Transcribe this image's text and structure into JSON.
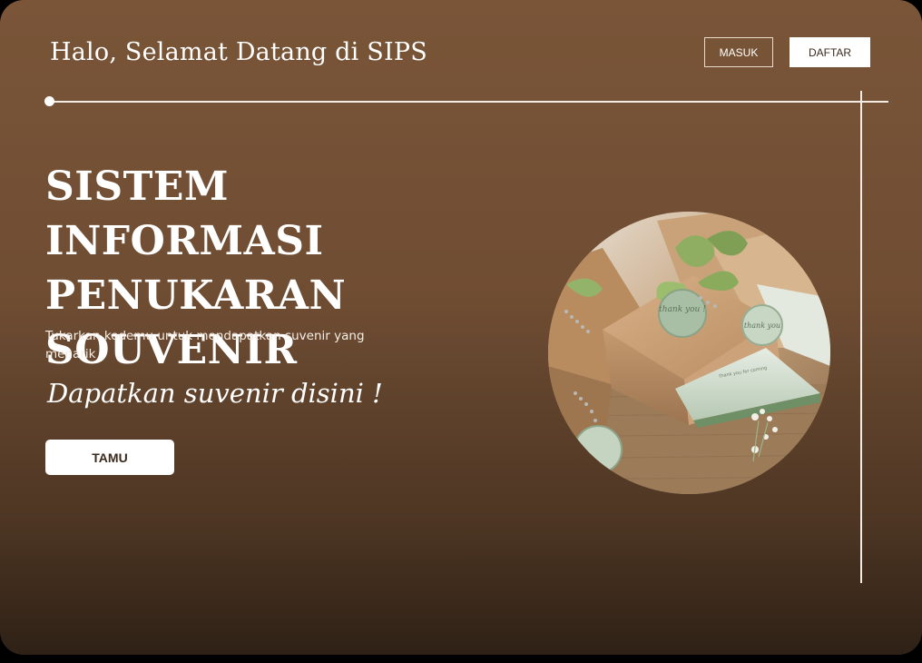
{
  "header": {
    "greeting": "Halo, Selamat Datang di SIPS",
    "login_label": "MASUK",
    "register_label": "DAFTAR"
  },
  "hero": {
    "title_lines": [
      "SISTEM INFORMASI",
      "PENUKARAN",
      "SOUVENIR"
    ],
    "subtitle": "Tukarkan kodemu untuk mendapatkan suvenir yang menarik",
    "script_text": "Dapatkan suvenir disini !",
    "guest_button_label": "TAMU"
  },
  "photo": {
    "tag_text_1": "thank you !",
    "tag_text_2": "thank you",
    "box_text": "thank you for coming"
  },
  "colors": {
    "background_top": "#7a5538",
    "background_bottom": "#2f2116",
    "button_text": "#3b2a1d",
    "ribbon_green": "#8fae62",
    "kraft": "#c79a6c"
  }
}
